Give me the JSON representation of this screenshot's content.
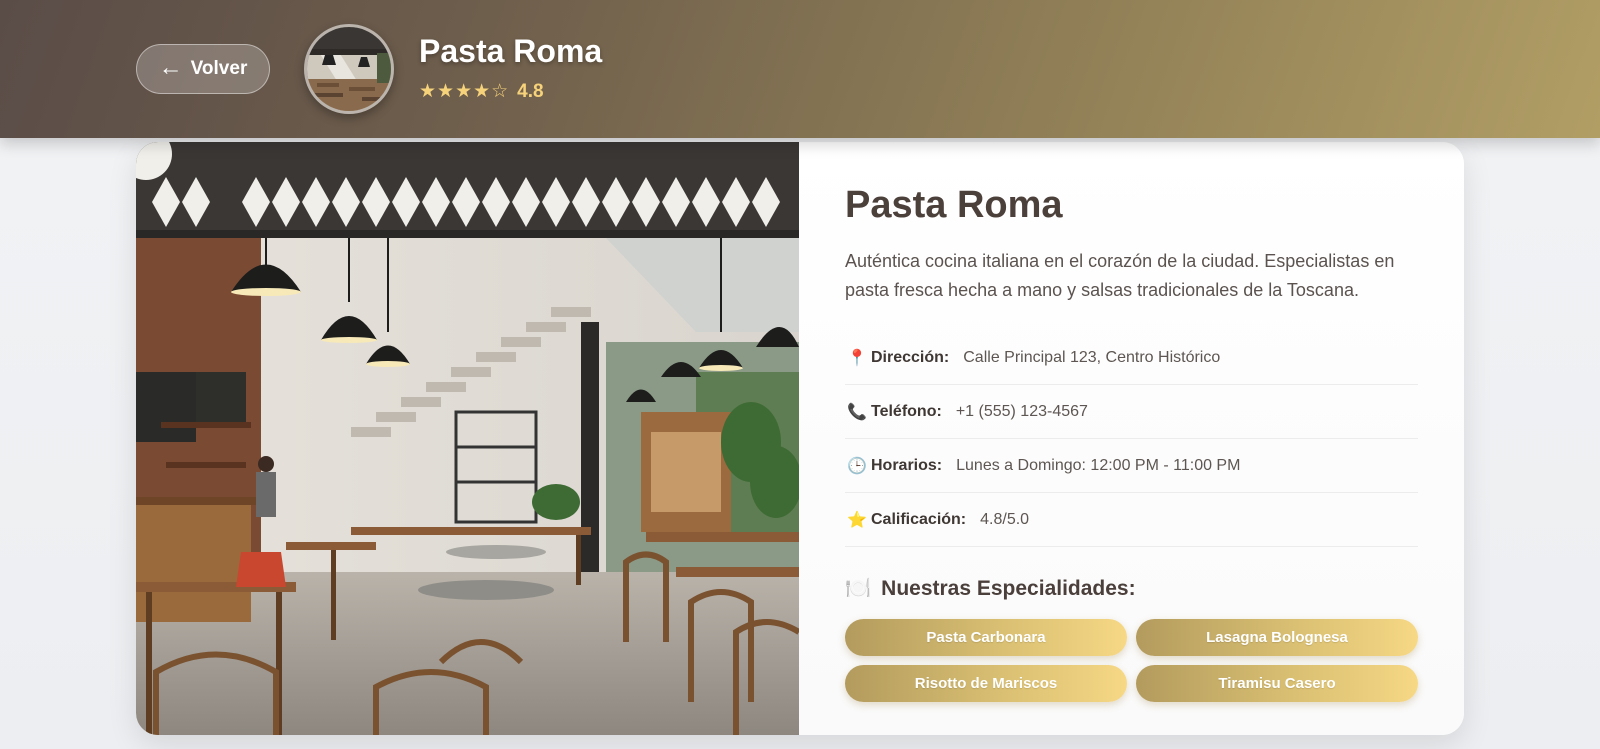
{
  "header": {
    "back_label": "Volver",
    "back_arrow": "←",
    "title": "Pasta Roma",
    "stars": "★★★★☆",
    "rating": "4.8"
  },
  "restaurant": {
    "name": "Pasta Roma",
    "description": "Auténtica cocina italiana en el corazón de la ciudad. Especialistas en pasta fresca hecha a mano y salsas tradicionales de la Toscana.",
    "details": [
      {
        "icon": "location-pin-icon",
        "glyph": "📍",
        "label": "Dirección:",
        "value": "Calle Principal 123, Centro Histórico"
      },
      {
        "icon": "phone-icon",
        "glyph": "📞",
        "label": "Teléfono:",
        "value": "+1 (555) 123-4567"
      },
      {
        "icon": "clock-icon",
        "glyph": "🕒",
        "label": "Horarios:",
        "value": "Lunes a Domingo: 12:00 PM - 11:00 PM"
      },
      {
        "icon": "star-icon",
        "glyph": "⭐",
        "label": "Calificación:",
        "value": "4.8/5.0"
      }
    ],
    "specialties_title": "Nuestras Especialidades:",
    "specialties_glyph": "🍽️",
    "specialties": [
      "Pasta Carbonara",
      "Lasagna Bolognesa",
      "Risotto de Mariscos",
      "Tiramisu Casero"
    ]
  },
  "colors": {
    "header_start": "#5a4c47",
    "header_end": "#b19e65",
    "gold_accent": "#f6d27a",
    "pill_start": "#b39b5e",
    "pill_end": "#f6d885"
  }
}
